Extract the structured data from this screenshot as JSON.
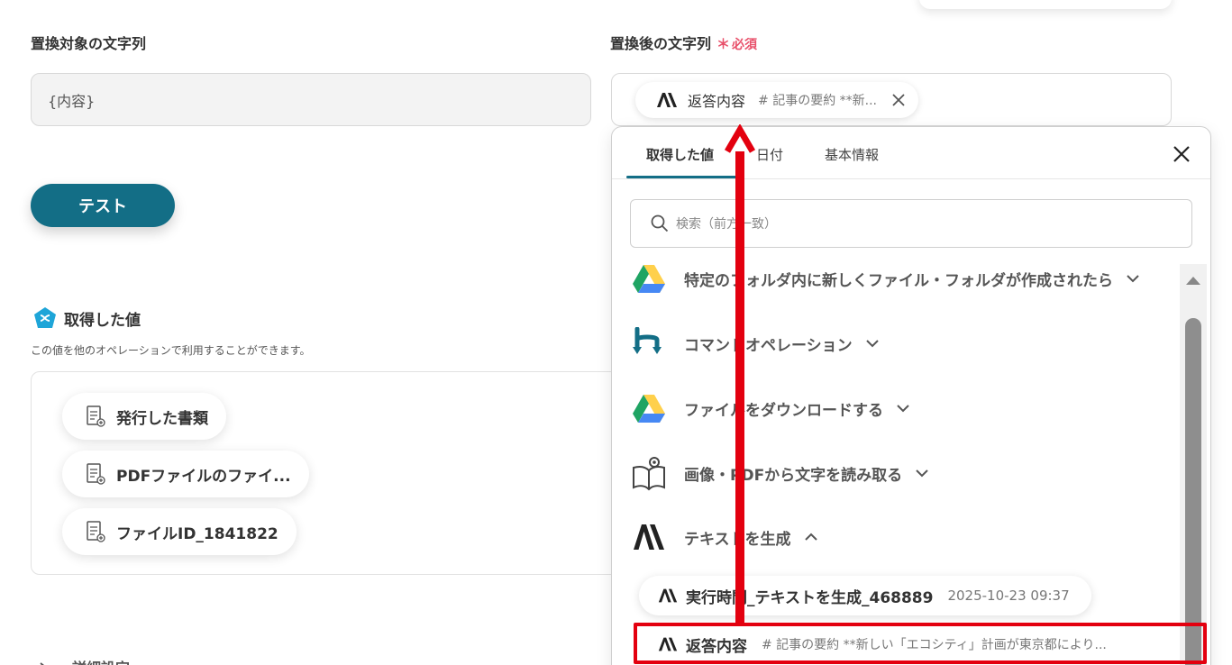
{
  "form": {
    "target_label": "置換対象の文字列",
    "target_value": "{内容}",
    "replacement_label": "置換後の文字列",
    "required_star": "＊",
    "required_text": "必須",
    "replacement_chip": {
      "label": "返答内容",
      "preview": "# 記事の要約 **新..."
    }
  },
  "test_button": "テスト",
  "obtained": {
    "title": "取得した値",
    "description": "この値を他のオペレーションで利用することができます。",
    "items": [
      "発行した書類",
      "PDFファイルのファイ...",
      "ファイルID_1841822"
    ]
  },
  "advanced_label": "詳細設定",
  "picker": {
    "tabs": [
      "取得した値",
      "日付",
      "基本情報"
    ],
    "active_tab": "取得した値",
    "search_placeholder": "検索（前方一致）",
    "groups": [
      {
        "label": "特定のフォルダ内に新しくファイル・フォルダが作成されたら",
        "icon": "google-drive-icon",
        "expanded": false
      },
      {
        "label": "コマンドオペレーション",
        "icon": "command-operation-icon",
        "expanded": false
      },
      {
        "label": "ファイルをダウンロードする",
        "icon": "google-drive-icon",
        "expanded": false
      },
      {
        "label": "画像・PDFから文字を読み取る",
        "icon": "ocr-book-icon",
        "expanded": false
      },
      {
        "label": "テキストを生成",
        "icon": "anthropic-icon",
        "expanded": true
      }
    ],
    "sub_items": [
      {
        "label": "実行時間_テキストを生成_468889",
        "meta": "2025-10-23 09:37"
      },
      {
        "label": "返答内容",
        "meta": "# 記事の要約 **新しい「エコシティ」計画が東京都により..."
      }
    ]
  },
  "colors": {
    "accent": "#136e86",
    "required": "#e8506a",
    "annotation": "#e3000f",
    "drive_green": "#1fa463",
    "drive_yellow": "#ffd04b",
    "drive_blue": "#4688f4"
  }
}
